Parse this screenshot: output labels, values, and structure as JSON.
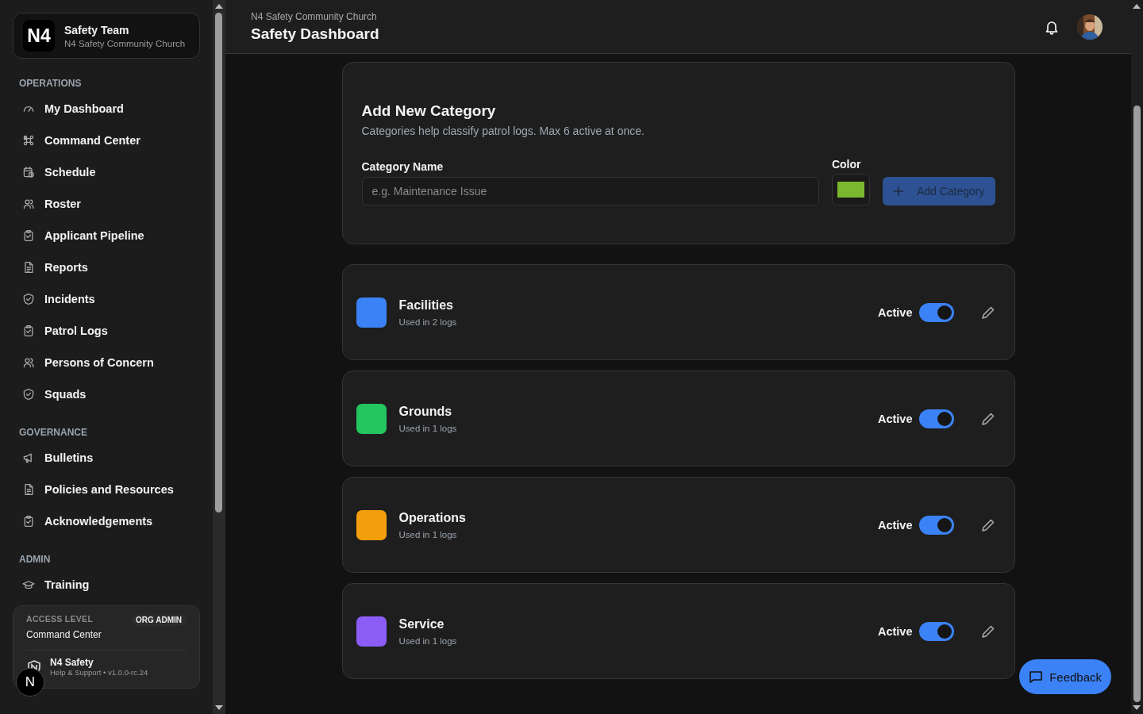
{
  "sidebar": {
    "org": {
      "logo": "N4",
      "name": "Safety Team",
      "subtitle": "N4 Safety Community Church"
    },
    "sections": [
      {
        "title": "OPERATIONS",
        "items": [
          {
            "label": "My Dashboard"
          },
          {
            "label": "Command Center"
          },
          {
            "label": "Schedule"
          },
          {
            "label": "Roster"
          },
          {
            "label": "Applicant Pipeline"
          },
          {
            "label": "Reports"
          },
          {
            "label": "Incidents"
          },
          {
            "label": "Patrol Logs"
          },
          {
            "label": "Persons of Concern"
          },
          {
            "label": "Squads"
          }
        ]
      },
      {
        "title": "GOVERNANCE",
        "items": [
          {
            "label": "Bulletins"
          },
          {
            "label": "Policies and Resources"
          },
          {
            "label": "Acknowledgements"
          }
        ]
      },
      {
        "title": "ADMIN",
        "items": [
          {
            "label": "Training"
          }
        ]
      }
    ],
    "access": {
      "label": "ACCESS LEVEL",
      "value": "Command Center",
      "role": "ORG ADMIN",
      "app_name": "N4 Safety",
      "app_info": "Help & Support • v1.0.0-rc.24"
    },
    "dev_badge": "N"
  },
  "header": {
    "org": "N4 Safety Community Church",
    "title": "Safety Dashboard"
  },
  "form": {
    "title": "Add New Category",
    "description": "Categories help classify patrol logs. Max 6 active at once.",
    "name_label": "Category Name",
    "placeholder": "e.g. Maintenance Issue",
    "color_label": "Color",
    "color": "#7cb82f",
    "button": "Add Category"
  },
  "categories": [
    {
      "name": "Facilities",
      "usage": "Used in 2 logs",
      "color": "#3b82f6",
      "status_label": "Active",
      "active": true
    },
    {
      "name": "Grounds",
      "usage": "Used in 1 logs",
      "color": "#22c55e",
      "status_label": "Active",
      "active": true
    },
    {
      "name": "Operations",
      "usage": "Used in 1 logs",
      "color": "#f59e0b",
      "status_label": "Active",
      "active": true
    },
    {
      "name": "Service",
      "usage": "Used in 1 logs",
      "color": "#8b5cf6",
      "status_label": "Active",
      "active": true
    }
  ],
  "feedback": "Feedback"
}
